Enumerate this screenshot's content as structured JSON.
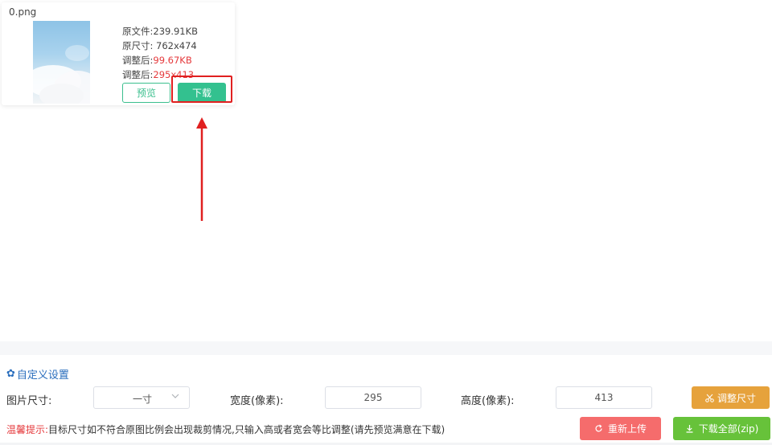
{
  "file": {
    "name": "0.png",
    "original_size_label": "原文件:",
    "original_size": "239.91KB",
    "original_dims_label": "原尺寸:",
    "original_dims": " 762x474",
    "adjusted_size_label": "调整后:",
    "adjusted_size": "99.67KB",
    "adjusted_dims_label": "调整后:",
    "adjusted_dims": "295x413",
    "preview_label": "预览",
    "download_label": "下载"
  },
  "settings": {
    "title": "自定义设置",
    "size_label": "图片尺寸:",
    "size_value": "一寸",
    "width_label": "宽度(像素):",
    "width_value": "295",
    "height_label": "高度(像素):",
    "height_value": "413",
    "resize_label": "调整尺寸"
  },
  "tip": {
    "label": "温馨提示:",
    "text": "目标尺寸如不符合原图比例会出现裁剪情况,只输入高或者宽会等比调整(请先预览满意在下载)"
  },
  "actions": {
    "reupload_label": "重新上传",
    "download_all_label": "下载全部(zip)"
  },
  "colors": {
    "green": "#33c18f",
    "orange": "#e6a23c",
    "red": "#f56c6c",
    "lime": "#67c23a",
    "link_blue": "#2a6ebd",
    "annotation_red": "#e02020"
  }
}
